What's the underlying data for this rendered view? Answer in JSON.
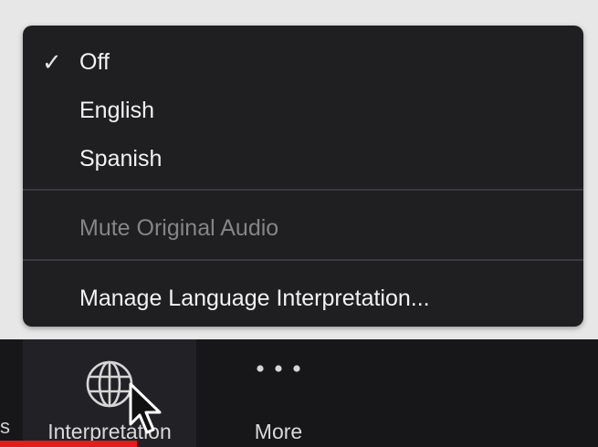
{
  "menu": {
    "items": [
      {
        "label": "Off",
        "checked": true
      },
      {
        "label": "English",
        "checked": false
      },
      {
        "label": "Spanish",
        "checked": false
      }
    ],
    "mute_label": "Mute Original Audio",
    "manage_label": "Manage Language Interpretation..."
  },
  "toolbar": {
    "left_edge_text": "s",
    "interpretation_label": "Interpretation",
    "more_label": "More",
    "interpretation_icon": "globe-icon",
    "more_icon": "more-dots-icon"
  },
  "colors": {
    "menu_bg": "#1f1f22",
    "toolbar_bg": "#17171a",
    "disabled_text": "#858585",
    "progress": "#e21d1d"
  }
}
